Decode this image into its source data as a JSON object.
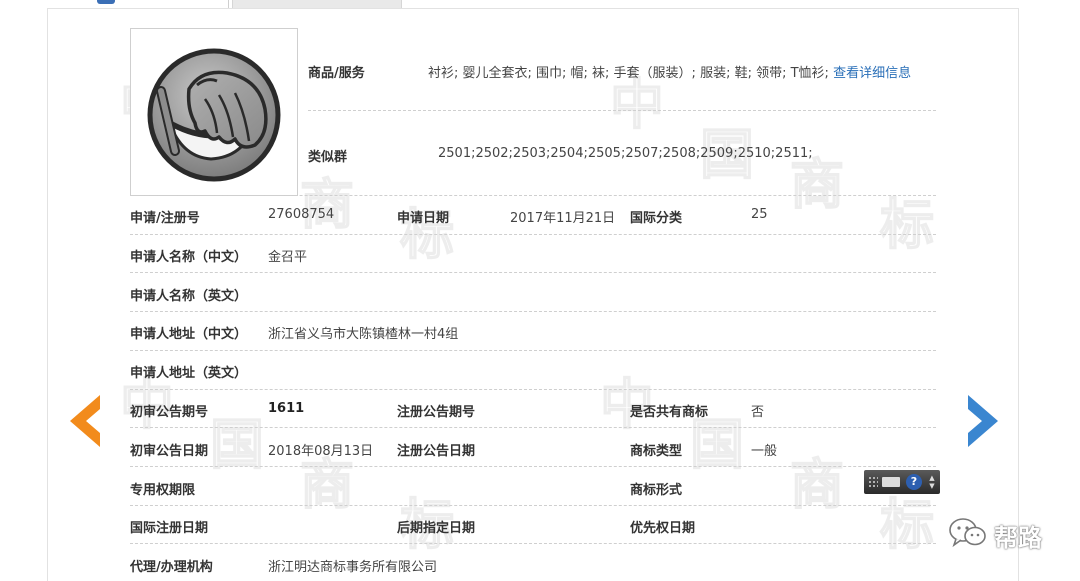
{
  "trademark": {
    "goods_services_label": "商品/服务",
    "goods_services_value": "衬衫; 婴儿全套衣; 围巾; 帽; 袜; 手套（服装）; 服装; 鞋; 领带; T恤衫;",
    "detail_link": "查看详细信息",
    "similar_group_label": "类似群",
    "similar_group_value": "2501;2502;2503;2504;2505;2507;2508;2509;2510;2511;"
  },
  "fields": {
    "reg_no_label": "申请/注册号",
    "reg_no_value": "27608754",
    "apply_date_label": "申请日期",
    "apply_date_value": "2017年11月21日",
    "intl_class_label": "国际分类",
    "intl_class_value": "25",
    "applicant_cn_label": "申请人名称（中文）",
    "applicant_cn_value": "金召平",
    "applicant_en_label": "申请人名称（英文）",
    "address_cn_label": "申请人地址（中文）",
    "address_cn_value": "浙江省义乌市大陈镇楂林一村4组",
    "address_en_label": "申请人地址（英文）",
    "prelim_issue_label": "初审公告期号",
    "prelim_issue_value": "1611",
    "reg_issue_label": "注册公告期号",
    "shared_label": "是否共有商标",
    "shared_value": "否",
    "prelim_date_label": "初审公告日期",
    "prelim_date_value": "2018年08月13日",
    "reg_date_label": "注册公告日期",
    "tm_type_label": "商标类型",
    "tm_type_value": "一般",
    "exclusive_label": "专用权期限",
    "tm_form_label": "商标形式",
    "intl_reg_date_label": "国际注册日期",
    "later_date_label": "后期指定日期",
    "priority_date_label": "优先权日期",
    "agent_label": "代理/办理机构",
    "agent_value": "浙江明达商标事务所有限公司"
  },
  "watermark_chars": [
    "中",
    "国",
    "商",
    "标"
  ],
  "widget": {
    "help_glyph": "?"
  },
  "footer": {
    "account_name": "帮路"
  },
  "icons": {
    "trademark_image": "facepalm-emoji-icon",
    "prev": "chevron-left-icon",
    "next": "chevron-right-icon",
    "wechat": "wechat-icon"
  },
  "colors": {
    "link": "#2a6fb8",
    "prev_arrow": "#f28b1c",
    "next_arrow": "#3a86d0",
    "tab_accent": "#3b6fb6"
  }
}
